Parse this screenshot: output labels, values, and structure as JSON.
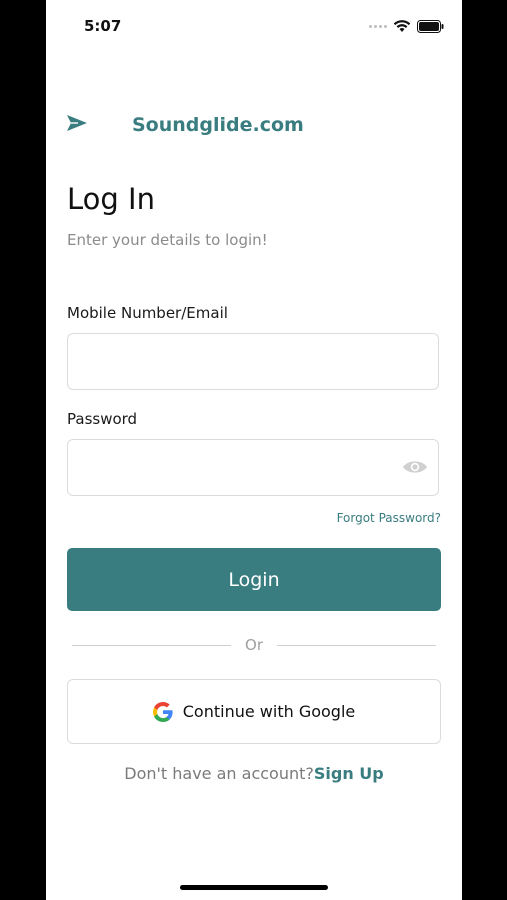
{
  "status_bar": {
    "time": "5:07"
  },
  "brand": {
    "name": "Soundglide.com",
    "icon": "paper-plane-icon"
  },
  "header": {
    "title": "Log In",
    "subtitle": "Enter your details to login!"
  },
  "form": {
    "username_label": "Mobile Number/Email",
    "username_value": "",
    "password_label": "Password",
    "password_value": "",
    "forgot_label": "Forgot Password?",
    "login_label": "Login"
  },
  "divider": {
    "label": "Or"
  },
  "social": {
    "google_label": "Continue with Google",
    "icon": "google-icon"
  },
  "signup": {
    "prompt": "Don't have an account?",
    "link": "Sign Up"
  },
  "colors": {
    "accent": "#3a7d80",
    "muted_text": "#8b8b8b",
    "border": "#dcdcdc"
  }
}
